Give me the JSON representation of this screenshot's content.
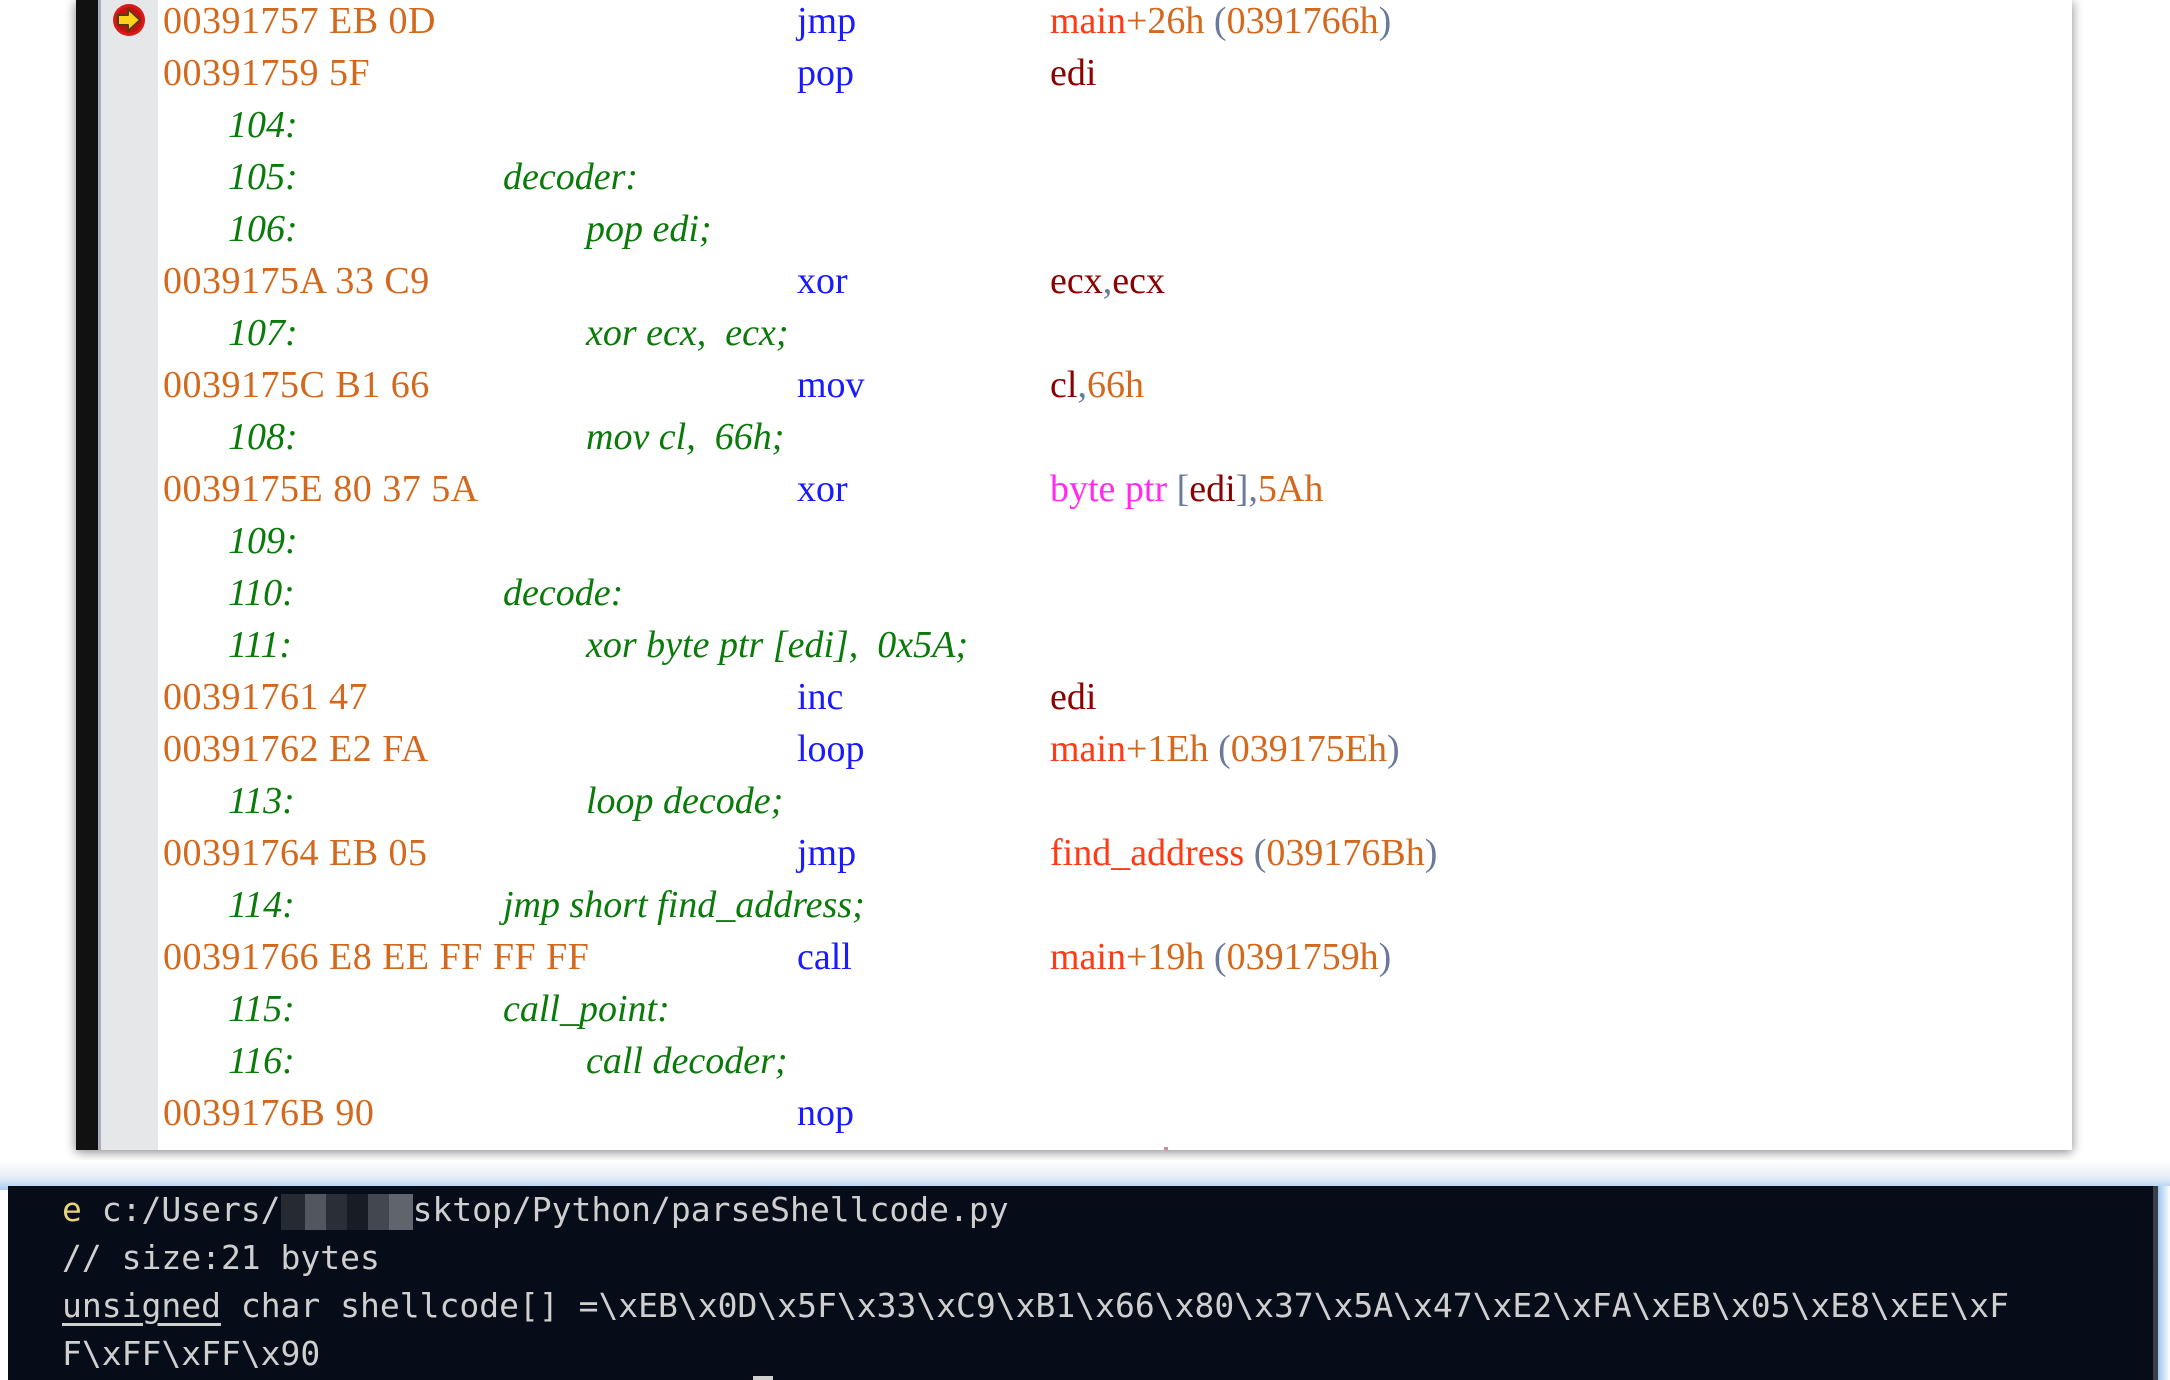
{
  "disassembly": {
    "current_instruction_marker": "arrow-right-icon",
    "rows": [
      {
        "type": "asm",
        "address": "00391757",
        "bytes": "EB 0D",
        "mnemonic": "jmp",
        "operands": [
          {
            "t": "sym",
            "v": "main"
          },
          {
            "t": "num",
            "v": "+26h"
          },
          {
            "t": "plain",
            "v": " "
          },
          {
            "t": "punc",
            "v": "("
          },
          {
            "t": "num",
            "v": "0391766h"
          },
          {
            "t": "punc",
            "v": ")"
          }
        ],
        "current": true
      },
      {
        "type": "asm",
        "address": "00391759",
        "bytes": "5F",
        "mnemonic": "pop",
        "operands": [
          {
            "t": "reg",
            "v": "edi"
          }
        ]
      },
      {
        "type": "src",
        "line": "104:",
        "indent": 0,
        "text": ""
      },
      {
        "type": "src",
        "line": "105:",
        "indent": 1,
        "text": "decoder:"
      },
      {
        "type": "src",
        "line": "106:",
        "indent": 2,
        "text": "pop edi;"
      },
      {
        "type": "asm",
        "address": "0039175A",
        "bytes": "33 C9",
        "mnemonic": "xor",
        "operands": [
          {
            "t": "reg",
            "v": "ecx"
          },
          {
            "t": "punc",
            "v": ","
          },
          {
            "t": "reg",
            "v": "ecx"
          }
        ]
      },
      {
        "type": "src",
        "line": "107:",
        "indent": 2,
        "text": "xor ecx,  ecx;"
      },
      {
        "type": "asm",
        "address": "0039175C",
        "bytes": "B1 66",
        "mnemonic": "mov",
        "operands": [
          {
            "t": "reg",
            "v": "cl"
          },
          {
            "t": "punc",
            "v": ","
          },
          {
            "t": "num",
            "v": "66h"
          }
        ]
      },
      {
        "type": "src",
        "line": "108:",
        "indent": 2,
        "text": "mov cl,  66h;"
      },
      {
        "type": "asm",
        "address": "0039175E",
        "bytes": "80 37 5A",
        "mnemonic": "xor",
        "operands": [
          {
            "t": "kw",
            "v": "byte ptr"
          },
          {
            "t": "plain",
            "v": " "
          },
          {
            "t": "punc",
            "v": "["
          },
          {
            "t": "reg",
            "v": "edi"
          },
          {
            "t": "punc",
            "v": "],"
          },
          {
            "t": "num",
            "v": "5Ah"
          }
        ]
      },
      {
        "type": "src",
        "line": "109:",
        "indent": 0,
        "text": ""
      },
      {
        "type": "src",
        "line": "110:",
        "indent": 1,
        "text": "decode:"
      },
      {
        "type": "src",
        "line": "111:",
        "indent": 2,
        "text": "xor byte ptr [edi],  0x5A;"
      },
      {
        "type": "asm",
        "address": "00391761",
        "bytes": "47",
        "mnemonic": "inc",
        "operands": [
          {
            "t": "reg",
            "v": "edi"
          }
        ]
      },
      {
        "type": "asm",
        "address": "00391762",
        "bytes": "E2 FA",
        "mnemonic": "loop",
        "operands": [
          {
            "t": "sym",
            "v": "main"
          },
          {
            "t": "num",
            "v": "+1Eh"
          },
          {
            "t": "plain",
            "v": " "
          },
          {
            "t": "punc",
            "v": "("
          },
          {
            "t": "num",
            "v": "039175Eh"
          },
          {
            "t": "punc",
            "v": ")"
          }
        ]
      },
      {
        "type": "src",
        "line": "113:",
        "indent": 2,
        "text": "loop decode;"
      },
      {
        "type": "asm",
        "address": "00391764",
        "bytes": "EB 05",
        "mnemonic": "jmp",
        "operands": [
          {
            "t": "sym",
            "v": "find_address"
          },
          {
            "t": "plain",
            "v": " "
          },
          {
            "t": "punc",
            "v": "("
          },
          {
            "t": "num",
            "v": "039176Bh"
          },
          {
            "t": "punc",
            "v": ")"
          }
        ]
      },
      {
        "type": "src",
        "line": "114:",
        "indent": 1,
        "text": "jmp short find_address;"
      },
      {
        "type": "asm",
        "address": "00391766",
        "bytes": "E8 EE FF FF FF",
        "mnemonic": "call",
        "operands": [
          {
            "t": "sym",
            "v": "main"
          },
          {
            "t": "num",
            "v": "+19h"
          },
          {
            "t": "plain",
            "v": " "
          },
          {
            "t": "punc",
            "v": "("
          },
          {
            "t": "num",
            "v": "0391759h"
          },
          {
            "t": "punc",
            "v": ")"
          }
        ]
      },
      {
        "type": "src",
        "line": "115:",
        "indent": 1,
        "text": "call_point:"
      },
      {
        "type": "src",
        "line": "116:",
        "indent": 2,
        "text": "call decoder;"
      },
      {
        "type": "asm",
        "address": "0039176B",
        "bytes": "90",
        "mnemonic": "nop",
        "operands": []
      }
    ]
  },
  "terminal": {
    "line1": {
      "prompt_char": "e",
      "path_before": " c:/Users/",
      "path_after": "sktop/Python/parseShellcode.py"
    },
    "line2": "// size:21 bytes",
    "line3": {
      "keyword": "unsigned",
      "rest": " char shellcode[] =\\xEB\\x0D\\x5F\\x33\\xC9\\xB1\\x66\\x80\\x37\\x5A\\x47\\xE2\\xFA\\xEB\\x05\\xE8\\xEE\\xF"
    },
    "line4": "F\\xFF\\xFF\\x90"
  },
  "colors": {
    "address": "#d2691e",
    "mnemonic": "#1a1aff",
    "source": "#0a7a0a",
    "register": "#8b0000",
    "number": "#d2691e",
    "symbol": "#ff3a14",
    "keyword": "#ff2cf0",
    "terminal_bg": "#060c18"
  }
}
